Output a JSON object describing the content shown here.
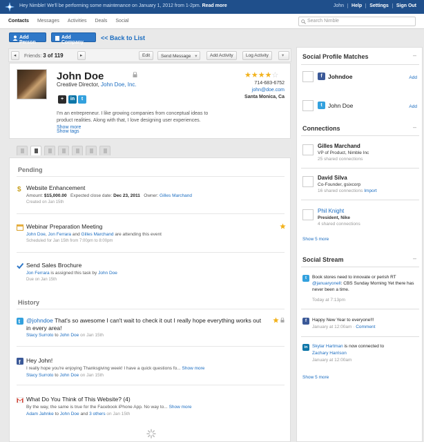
{
  "topbar": {
    "announcement_prefix": "Hey Nimble! We'll be performing some maintenance on January 1, 2012 from 1-2pm.",
    "announcement_link": "Read more",
    "links": [
      "John",
      "Help",
      "Settings",
      "Sign Out"
    ]
  },
  "nav": {
    "tabs": [
      "Contacts",
      "Messages",
      "Activities",
      "Deals",
      "Social"
    ],
    "active_tab": "Contacts",
    "search_placeholder": "Search Nimble"
  },
  "actions": {
    "add_person": "Add Person",
    "add_company": "Add Company",
    "back": "<< Back to List"
  },
  "toolbar": {
    "friends_label": "Friends:",
    "friends_pos": "3 of 119",
    "edit": "Edit",
    "send_message": "Send Message",
    "add_activity": "Add Activity",
    "log_activity": "Log Activity"
  },
  "profile": {
    "name": "John Doe",
    "title_prefix": "Creative Director,",
    "company": "John Doe, Inc.",
    "rating": 4,
    "rating_max": 5,
    "phone": "714-683-6752",
    "email": "john@doe.com",
    "location": "Santa Monica, Ca",
    "bio": "I'm an entrepreneur. I like growing companies from conceptual ideas to product realities. Along with that, I love designing user experiences.",
    "show_more": "Show more",
    "show_tags": "Show tags",
    "social_badges": [
      "+",
      "in",
      "t"
    ]
  },
  "feed": {
    "pending_heading": "Pending",
    "history_heading": "History",
    "pending": [
      {
        "title": "Website Enhancement",
        "amount_label": "Amount:",
        "amount": "$15,000.00",
        "close_label": "Expected close date:",
        "close_date": "Dec 23, 2011",
        "owner_label": "Owner:",
        "owner": "Gilles Marchand",
        "meta": "Created on Jan 15th"
      },
      {
        "title": "Webinar Preparation Meeting",
        "p1": "John Doe",
        "p2": "Jon Ferrara",
        "and": "and",
        "p3": "Gilles Marchand",
        "rest": "are attending this event",
        "meta": "Scheduled for Jan 15th from 7:00pm to 8:00pm"
      },
      {
        "title": "Send Sales Brochure",
        "assignee": "Jon Ferrara",
        "mid": "is assigned this task by",
        "assigner": "John Doe",
        "meta": "Due on Jan 15th"
      }
    ],
    "history": [
      {
        "handle": "@johndoe",
        "title_rest": "That's so awesome I can't wait to check it out I really hope everything works out",
        "title_line2": "in every area!",
        "from": "Stacy Surroto",
        "to_word": "to",
        "to": "John Doe",
        "when": "on Jan 15th"
      },
      {
        "title": "Hey John!",
        "body": "I really hope you're enjoying Thanksgiving week! I have a quick questions fo...",
        "more": "Show more",
        "from": "Stacy Surroto",
        "to_word": "to",
        "to": "John Doe",
        "when": "on Jan 15th"
      },
      {
        "title": "What Do You Think of This Website? (4)",
        "body": "By the way, the same is true for the Facebook iPhone App. No way to...",
        "more": "Show more",
        "from": "Adam Jahnke",
        "to_word": "to",
        "to": "John Doe",
        "and": "and",
        "others": "3 others",
        "when": "on Jan 15th"
      }
    ]
  },
  "sidebar": {
    "matches_heading": "Social Profile Matches",
    "matches": [
      {
        "name": "Johndoe",
        "add": "Add"
      },
      {
        "name": "John Doe",
        "add": "Add"
      }
    ],
    "connections_heading": "Connections",
    "connections": [
      {
        "name": "Gilles Marchand",
        "role": "VP of Product, Nimble Inc",
        "shared": "25 shared connections",
        "import": ""
      },
      {
        "name": "David Silva",
        "role": "Co-Founder, gsixcorp",
        "shared": "16 shared connections",
        "import": "Import"
      },
      {
        "name": "Phil Knight",
        "role": "President, Nike",
        "shared": "4 shared connections",
        "import": ""
      }
    ],
    "connections_more": "Show 5 more",
    "stream_heading": "Social Stream",
    "stream": [
      {
        "text1": "Book stores need to innovate or perish RT",
        "handle": "@januaryonell",
        "text2": ": CBS Sunday Morning Yet there has never been a time.",
        "when": "Today at 7:13pm",
        "extra": ""
      },
      {
        "text1": "Happy New Year to everyone!!!",
        "handle": "",
        "text2": "",
        "when": "January at 12:00am",
        "extra": "Comment"
      },
      {
        "text1": "Skylar Hartman",
        "handle": "",
        "text2": "is now connected to",
        "person": "Zachary Harrison",
        "when": "January at 12:00am",
        "extra": ""
      }
    ],
    "stream_more": "Show 5 more"
  }
}
